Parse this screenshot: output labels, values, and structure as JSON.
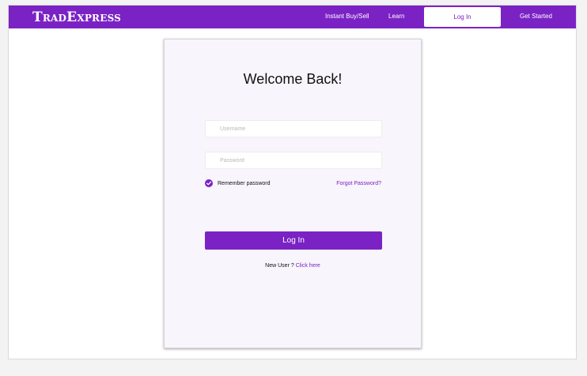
{
  "navbar": {
    "logo_prefix_big": "T",
    "logo_prefix_small": "RAD",
    "logo_suffix_big": "E",
    "logo_suffix_small": "XPRESS",
    "links": {
      "instant": "Instant Buy/Sell",
      "learn": "Learn",
      "login": "Log In",
      "get_started": "Get Started"
    }
  },
  "login_card": {
    "title": "Welcome Back!",
    "username_placeholder": "Username",
    "password_placeholder": "Password",
    "remember_label": "Remember password",
    "remember_checked": true,
    "forgot_label": "Forgot Password?",
    "submit_label": "Log In",
    "new_user_text": "New User ? ",
    "click_here_label": "Click here"
  },
  "colors": {
    "brand": "#7b22c4",
    "card_bg": "#f8f5fc"
  },
  "icons": {
    "remember_check": "check-circle-icon"
  }
}
